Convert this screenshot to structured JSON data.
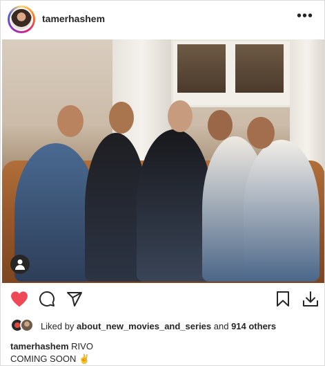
{
  "post": {
    "username": "tamerhashem",
    "more_label": "•••"
  },
  "likes": {
    "prefix": "Liked by ",
    "top_liker": "about_new_movies_and_series",
    "middle": " and ",
    "others": "914 others"
  },
  "caption": {
    "username": "tamerhashem",
    "line1": " RIVO",
    "line2": "COMING SOON ✌"
  },
  "icons": {
    "like": "heart-icon",
    "comment": "comment-icon",
    "share": "paper-plane-icon",
    "save": "bookmark-icon",
    "download": "download-icon",
    "tagged": "user-tag-icon",
    "more": "more-options-icon"
  },
  "colors": {
    "heart": "#ed4956",
    "text": "#262626",
    "border": "#dbdbdb"
  }
}
